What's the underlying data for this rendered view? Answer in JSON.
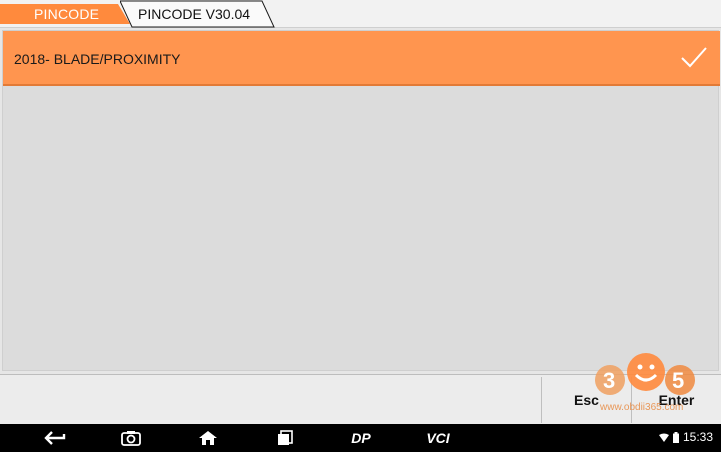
{
  "breadcrumb": {
    "items": [
      {
        "label": "PINCODE",
        "color": "#ff8a3d"
      },
      {
        "label": "PINCODE V30.04"
      }
    ]
  },
  "list": {
    "items": [
      {
        "label": "2018- BLADE/PROXIMITY",
        "selected": true,
        "icon": "checkmark-icon"
      }
    ]
  },
  "buttons": {
    "esc_label": "Esc",
    "enter_label": "Enter"
  },
  "watermark": {
    "url": "www.obdii365.com"
  },
  "navbar": {
    "dp_label": "DP",
    "vci_label": "VCI",
    "time": "15:33",
    "icons": [
      "back-icon",
      "camera-icon",
      "home-icon",
      "recent-apps-icon",
      "dp-icon",
      "vci-icon",
      "wifi-icon",
      "battery-icon"
    ]
  },
  "colors": {
    "accent": "#ff954f",
    "accent_dark": "#e27a36",
    "background": "#dcdcdc"
  }
}
